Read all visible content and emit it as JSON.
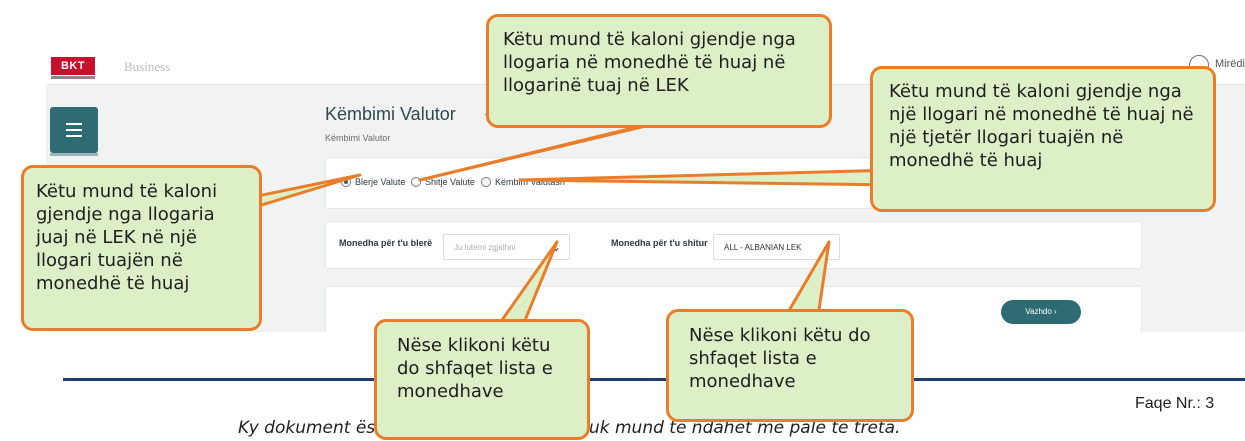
{
  "app": {
    "logo_text": "BKT",
    "brand": "Business",
    "user_greeting": "Mirëdi",
    "page_title": "Këmbimi Valutor",
    "breadcrumb": "Këmbimi Valutor",
    "radio_options": [
      {
        "label": "Blerje Valute",
        "checked": true
      },
      {
        "label": "Shitje Valute",
        "checked": false
      },
      {
        "label": "Këmbim Valutash",
        "checked": false
      }
    ],
    "buy_currency_label": "Monedha për t'u blerë",
    "buy_currency_placeholder": "Ju lutemi zgjidhni",
    "sell_currency_label": "Monedha për t'u shitur",
    "sell_currency_value": "ALL - ALBANIAN LEK",
    "next_button": "Vazhdo ›",
    "accent_color": "#2f6b73"
  },
  "callouts": {
    "top_center": "Këtu mund të kaloni gjendje nga llogaria në monedhë të huaj në llogarinë tuaj në LEK",
    "top_right": "Këtu mund të kaloni gjendje nga një llogari në monedhë të huaj në një tjetër llogari tuajën në monedhë të huaj",
    "left": "Këtu mund të kaloni gjendje nga llogaria juaj në LEK në një llogari tuajën në monedhë të huaj",
    "bottom_left": "Nëse klikoni këtu do shfaqet lista e monedhave",
    "bottom_right": "Nëse klikoni këtu do shfaqet lista e monedhave"
  },
  "document": {
    "page_number": "Faqe Nr.: 3",
    "disclaimer": "Ky dokument është pronë e BKT-së dhe nuk mund të ndahet me palë të treta."
  },
  "colors": {
    "callout_fill": "#dcefc6",
    "callout_border": "#e97d2a",
    "rule_line": "#1d3c78"
  }
}
